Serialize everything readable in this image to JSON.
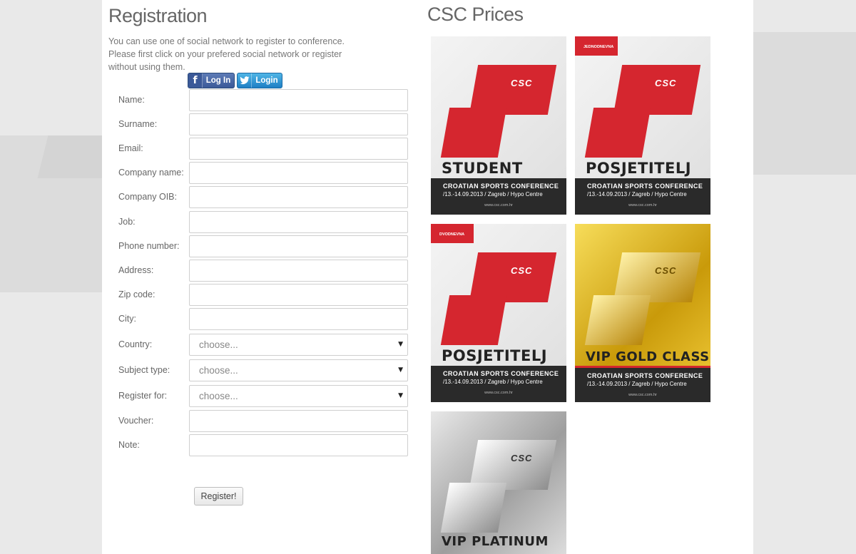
{
  "registration": {
    "title": "Registration",
    "intro": "You can use one of social network to register to conference. Please first click on your prefered social network or register without using them.",
    "social": {
      "facebook_label": "Log In",
      "twitter_label": "Login"
    },
    "fields": [
      {
        "label": "Name:",
        "value": ""
      },
      {
        "label": "Surname:",
        "value": ""
      },
      {
        "label": "Email:",
        "value": ""
      },
      {
        "label": "Company name:",
        "value": ""
      },
      {
        "label": "Company OIB:",
        "value": ""
      },
      {
        "label": "Job:",
        "value": ""
      },
      {
        "label": "Phone number:",
        "value": ""
      },
      {
        "label": "Address:",
        "value": ""
      },
      {
        "label": "Zip code:",
        "value": ""
      },
      {
        "label": "City:",
        "value": ""
      },
      {
        "label": "Country:",
        "value": "choose..."
      },
      {
        "label": "Subject type:",
        "value": "choose..."
      },
      {
        "label": "Register for:",
        "value": "choose..."
      },
      {
        "label": "Voucher:",
        "value": ""
      },
      {
        "label": "Note:",
        "value": ""
      }
    ],
    "submit_label": "Register!"
  },
  "prices": {
    "title": "CSC Prices",
    "cards": [
      {
        "name": "STUDENT",
        "tag": "",
        "line1": "CROATIAN SPORTS CONFERENCE",
        "line2": "/13.-14.09.2013 / Zagreb / Hypo Centre",
        "line3": "www.csc.com.hr",
        "logo": "CSC"
      },
      {
        "name": "POSJETITELJ",
        "tag": "JEDNODNEVNA",
        "line1": "CROATIAN SPORTS CONFERENCE",
        "line2": "/13.-14.09.2013 / Zagreb / Hypo Centre",
        "line3": "www.csc.com.hr",
        "logo": "CSC"
      },
      {
        "name": "POSJETITELJ",
        "tag": "DVODNEVNA",
        "line1": "CROATIAN SPORTS CONFERENCE",
        "line2": "/13.-14.09.2013 / Zagreb / Hypo Centre",
        "line3": "www.csc.com.hr",
        "logo": "CSC"
      },
      {
        "name": "VIP GOLD CLASS",
        "tag": "",
        "line1": "CROATIAN SPORTS CONFERENCE",
        "line2": "/13.-14.09.2013 / Zagreb / Hypo Centre",
        "line3": "www.csc.com.hr",
        "logo": "CSC"
      },
      {
        "name": "VIP PLATINUM",
        "tag": "",
        "line1": "",
        "line2": "",
        "line3": "",
        "logo": "CSC"
      }
    ]
  },
  "colors": {
    "brand_red": "#d5262f",
    "facebook_blue": "#3b5998",
    "twitter_blue": "#1f7fc4"
  },
  "icons": {
    "facebook": "facebook-icon",
    "twitter": "twitter-icon",
    "select_arrow": "dropdown-arrow-icon"
  }
}
